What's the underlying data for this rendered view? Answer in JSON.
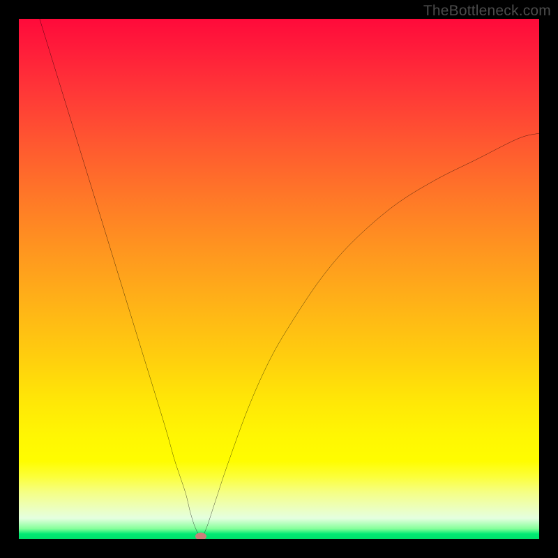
{
  "attribution": "TheBottleneck.com",
  "chart_data": {
    "type": "line",
    "title": "",
    "xlabel": "",
    "ylabel": "",
    "xlim": [
      0,
      100
    ],
    "ylim": [
      0,
      100
    ],
    "grid": false,
    "series": [
      {
        "name": "bottleneck-curve",
        "x": [
          4,
          8,
          12,
          16,
          20,
          24,
          28,
          30,
          32,
          33,
          34,
          35,
          36,
          38,
          40,
          44,
          48,
          52,
          58,
          64,
          72,
          80,
          88,
          96,
          100
        ],
        "y": [
          100,
          87,
          74,
          61,
          48,
          35,
          22,
          15,
          9,
          5,
          2,
          0.5,
          2,
          8,
          14,
          25,
          34,
          41,
          50,
          57,
          64,
          69,
          73,
          77,
          78
        ]
      }
    ],
    "marker": {
      "x": 35,
      "y": 0.5,
      "color": "#cd7d7a"
    },
    "background_gradient": {
      "top": "#ff0a3a",
      "mid": "#ffe607",
      "bottom": "#00e06c"
    }
  }
}
